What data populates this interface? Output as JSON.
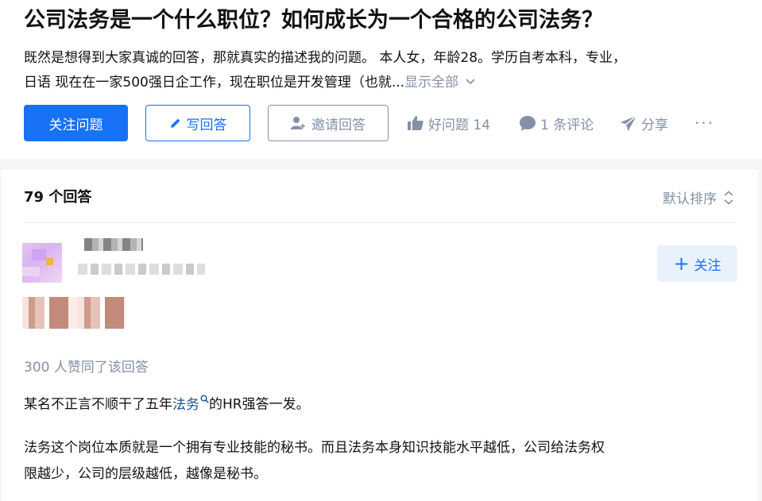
{
  "question": {
    "title": "公司法务是一个什么职位？如何成长为一个合格的公司法务？",
    "detail_line1": "既然是想得到大家真诚的回答，那就真实的描述我的问题。 本人女，年龄28。学历自考本科，专业，",
    "detail_line2": "日语 现在在一家500强日企工作，现在职位是开发管理（也就...",
    "show_all_label": "显示全部"
  },
  "actions": {
    "follow_question_label": "关注问题",
    "write_answer_label": "写回答",
    "invite_label": "邀请回答",
    "good_question_label": "好问题 14",
    "comment_label": "1 条评论",
    "share_label": "分享",
    "more_label": "···"
  },
  "answers": {
    "count_label": "79 个回答",
    "sort_label": "默认排序"
  },
  "answer": {
    "follow_label": "关注",
    "votes_label": "300 人赞同了该回答",
    "para1_pre": "某名不正言不顺干了五年",
    "para1_link": "法务",
    "para1_post": "的HR强答一发。",
    "para2_line1": "法务这个岗位本质就是一个拥有专业技能的秘书。而且法务本身知识技能水平越低，公司给法务权",
    "para2_line2": "限越少，公司的层级越低，越像是秘书。"
  },
  "colors": {
    "primary": "#1772f6",
    "muted": "#8590a6",
    "link": "#175199",
    "follow_bg": "#e9f1fd"
  },
  "icons": [
    "pencil-icon",
    "invite-user-icon",
    "thumbs-up-icon",
    "comment-bubble-icon",
    "paper-plane-icon",
    "more-icon",
    "chevron-down-icon",
    "sort-icon",
    "plus-icon",
    "search-icon"
  ]
}
